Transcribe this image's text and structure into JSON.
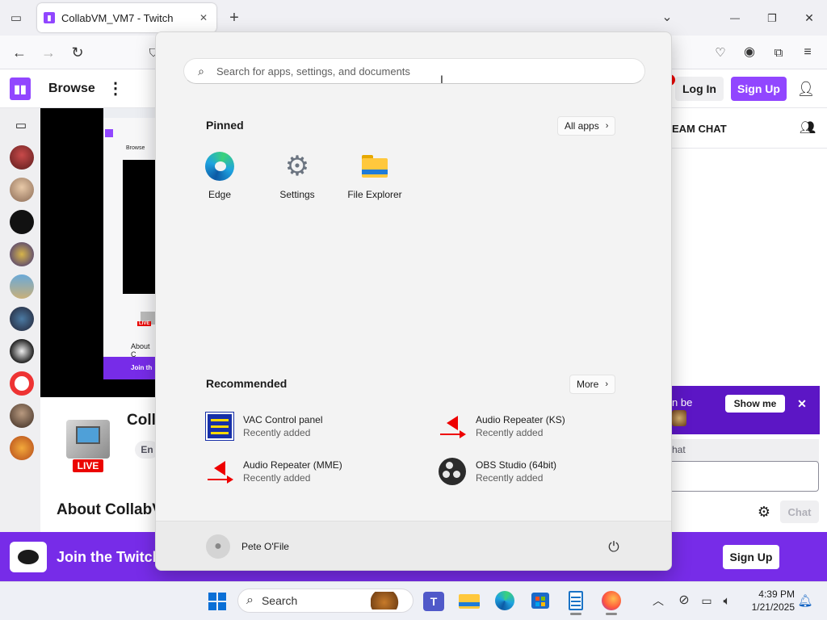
{
  "browser": {
    "tab_title": "CollabVM_VM7 - Twitch",
    "add_tab": "+",
    "tab_list": "⌄",
    "minimize": "—",
    "restore": "❐",
    "close": "✕"
  },
  "twitch": {
    "browse": "Browse",
    "more": "⋮",
    "login": "Log In",
    "signup": "Sign Up",
    "stream_chat": "EAM CHAT",
    "channel_partial": "Colla",
    "tag_partial": "En",
    "about_partial": "About CollabV",
    "inner_browse": "Browse",
    "inner_about": "About C",
    "inner_join": "Join th",
    "inner_live": "LIVE",
    "live_badge": "LIVE",
    "notice_partial": "n be",
    "show_me": "Show me",
    "chat_partial": "hat",
    "chat_button": "Chat",
    "join_text": "Join the Twitch",
    "join_signup": "Sign Up",
    "notif_count": ""
  },
  "start_menu": {
    "search_placeholder": "Search for apps, settings, and documents",
    "pinned_label": "Pinned",
    "all_apps": "All apps",
    "pinned": [
      {
        "label": "Edge",
        "icon": "edge-icon"
      },
      {
        "label": "Settings",
        "icon": "settings-gear-icon"
      },
      {
        "label": "File Explorer",
        "icon": "folder-icon"
      }
    ],
    "recommended_label": "Recommended",
    "more_label": "More",
    "recommended": [
      {
        "title": "VAC Control panel",
        "sub": "Recently added",
        "icon": "vac-panel-icon"
      },
      {
        "title": "Audio Repeater (KS)",
        "sub": "Recently added",
        "icon": "audio-repeater-icon"
      },
      {
        "title": "Audio Repeater (MME)",
        "sub": "Recently added",
        "icon": "audio-repeater-icon"
      },
      {
        "title": "OBS Studio (64bit)",
        "sub": "Recently added",
        "icon": "obs-icon"
      }
    ],
    "user_name": "Pete O'File"
  },
  "taskbar": {
    "search_label": "Search",
    "time": "4:39 PM",
    "date": "1/21/2025"
  },
  "colors": {
    "twitch_purple": "#9146ff",
    "join_bar": "#772ce8",
    "notice_purple": "#5c16c5",
    "live_red": "#eb0400"
  }
}
